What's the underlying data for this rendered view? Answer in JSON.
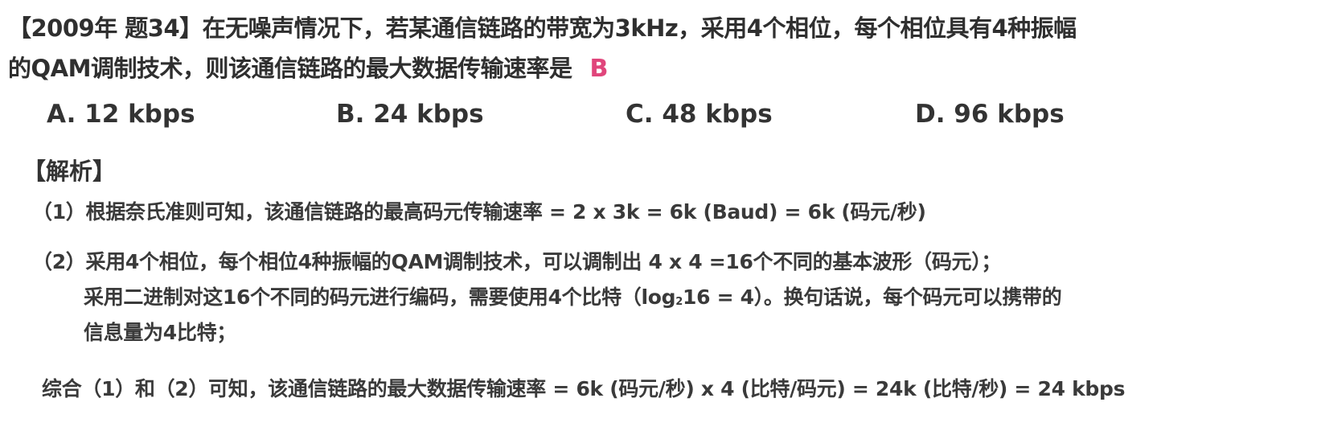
{
  "question": {
    "line1": "【2009年 题34】在无噪声情况下，若某通信链路的带宽为3kHz，采用4个相位，每个相位具有4种振幅",
    "line2": "的QAM调制技术，则该通信链路的最大数据传输速率是",
    "answer": "B"
  },
  "options": [
    {
      "label": "A. 12 kbps"
    },
    {
      "label": "B. 24 kbps"
    },
    {
      "label": "C. 48 kbps"
    },
    {
      "label": "D. 96 kbps"
    }
  ],
  "analysis": {
    "heading": "【解析】",
    "step1": "（1）根据奈氏准则可知，该通信链路的最高码元传输速率 = 2 x 3k = 6k (Baud) = 6k (码元/秒)",
    "step2_line1": "（2）采用4个相位，每个相位4种振幅的QAM调制技术，可以调制出 4 x 4 =16个不同的基本波形（码元）；",
    "step2_line2_pre": "采用二进制对这16个不同的码元进行编码，需要使用4个比特（log",
    "step2_line2_sub": "2",
    "step2_line2_post": "16 = 4）。换句话说，每个码元可以携带的",
    "step2_line3": "信息量为4比特；",
    "summary": "综合（1）和（2）可知，该通信链路的最大数据传输速率 = 6k (码元/秒) x 4 (比特/码元) = 24k (比特/秒) = 24 kbps"
  },
  "colors": {
    "answer": "#e0457b",
    "text": "#2f2f2f"
  }
}
